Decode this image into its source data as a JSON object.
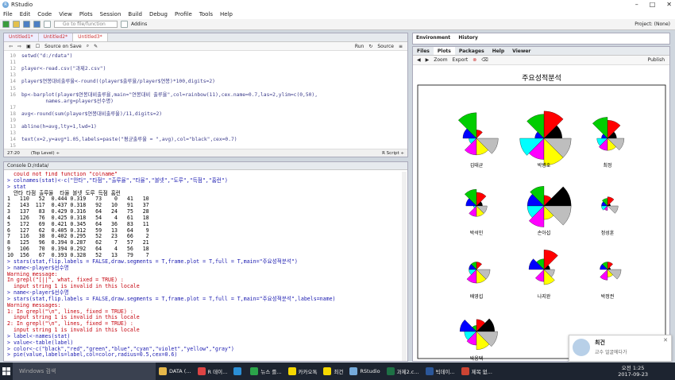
{
  "window": {
    "title": "RStudio"
  },
  "menu": [
    "File",
    "Edit",
    "Code",
    "View",
    "Plots",
    "Session",
    "Build",
    "Debug",
    "Profile",
    "Tools",
    "Help"
  ],
  "toolbar": {
    "goto_placeholder": "Go to file/function",
    "addins": "Addins",
    "project": "Project: (None)"
  },
  "editor": {
    "tabs": [
      "Untitled1*",
      "Untitled2*",
      "Untitled3*"
    ],
    "source_on_save": "Source on Save",
    "run": "Run",
    "source": "Source",
    "lines": [
      {
        "n": "10",
        "t": "setwd(\"d:/rdata\")"
      },
      {
        "n": "11",
        "t": ""
      },
      {
        "n": "12",
        "t": "player<-read.csv(\"과제2.csv\")"
      },
      {
        "n": "13",
        "t": ""
      },
      {
        "n": "14",
        "t": "player$연봉대비출루율<-round((player$출루율/player$연봉)*100,digits=2)"
      },
      {
        "n": "15",
        "t": ""
      },
      {
        "n": "16",
        "t": "bp<-barplot(player$연봉대비출루율,main=\"연봉대비 출루율\",col=rainbow(11),cex.name=0.7,las=2,ylim=c(0,50),"
      },
      {
        "n": "",
        "t": "        names.arg=player$선수명)"
      },
      {
        "n": "17",
        "t": ""
      },
      {
        "n": "18",
        "t": "avg<-round(sum(player$연봉대비출루율)/11,digits=2)"
      },
      {
        "n": "19",
        "t": ""
      },
      {
        "n": "13",
        "t": "abline(h=avg,lty=1,lwd=1)"
      },
      {
        "n": "13",
        "t": ""
      },
      {
        "n": "14",
        "t": "text(x=2,y=avg*1.05,labels=paste(\"평균출루율 = \",avg),col=\"black\",cex=0.7)"
      },
      {
        "n": "15",
        "t": ""
      }
    ],
    "status_pos": "27:20",
    "status_level": "(Top Level) ÷",
    "status_type": "R Script ÷"
  },
  "console": {
    "title": "Console  D:/rdata/",
    "lines": [
      {
        "k": "err",
        "t": "  could not find function \"colname\""
      },
      {
        "k": "cmd",
        "t": "> colnames(stat)<-c(\"안타\",\"타점\",\"출루율\",\"타율\",\"볼넷\",\"도루\",\"득점\",\"홈런\")"
      },
      {
        "k": "cmd",
        "t": "> stat"
      },
      {
        "k": "out",
        "t": "  안타 타점 출루율  타율 볼넷 도루 득점 홈런"
      },
      {
        "k": "out",
        "t": "1   110   52  0.444 0.319   73    0   41   10"
      },
      {
        "k": "out",
        "t": "2   143  117  0.437 0.318   92   10   91   37"
      },
      {
        "k": "out",
        "t": "3   137   83  0.429 0.316   64   24   75   28"
      },
      {
        "k": "out",
        "t": "4   126   76  0.425 0.318   54    4   61   18"
      },
      {
        "k": "out",
        "t": "5   172   69  0.421 0.345   64   36   83   11"
      },
      {
        "k": "out",
        "t": "6   127   62  0.405 0.312   59   13   64    9"
      },
      {
        "k": "out",
        "t": "7   116   38  0.402 0.295   52   23   66    2"
      },
      {
        "k": "out",
        "t": "8   125   96  0.394 0.287   62    7   57   21"
      },
      {
        "k": "out",
        "t": "9   106   70  0.394 0.292   64    4   56   18"
      },
      {
        "k": "out",
        "t": "10  156   67  0.393 0.328   52   13   79    7"
      },
      {
        "k": "cmd",
        "t": "> stars(stat,flip.labels = FALSE,draw.segments = T,frame.plot = T,full = T,main=\"주요성적분석\")"
      },
      {
        "k": "cmd",
        "t": "> name<-player$선수명"
      },
      {
        "k": "err",
        "t": "Warning message:"
      },
      {
        "k": "err",
        "t": "In grepl(\"[||\", what, fixed = TRUE) :"
      },
      {
        "k": "err",
        "t": "  input string 1 is invalid in this locale"
      },
      {
        "k": "cmd",
        "t": "> name<-player$선수명"
      },
      {
        "k": "cmd",
        "t": "> stars(stat,flip.labels = FALSE,draw.segments = T,frame.plot = T,full = T,main=\"주요성적분석\",labels=name)"
      },
      {
        "k": "err",
        "t": "Warning messages:"
      },
      {
        "k": "err",
        "t": "1: In grepl(\"\\n\", lines, fixed = TRUE) :"
      },
      {
        "k": "err",
        "t": "  input string 1 is invalid in this locale"
      },
      {
        "k": "err",
        "t": "2: In grepl(\"\\n\", lines, fixed = TRUE) :"
      },
      {
        "k": "err",
        "t": "  input string 1 is invalid in this locale"
      },
      {
        "k": "cmd",
        "t": "> label<-names(stat)"
      },
      {
        "k": "cmd",
        "t": "> value<-table(label)"
      },
      {
        "k": "cmd",
        "t": "> color<-c(\"black\",\"red\",\"green\",\"blue\",\"cyan\",\"violet\",\"yellow\",\"gray\")"
      },
      {
        "k": "cmd",
        "t": "> pie(value,labels=label,col=color,radius=0.5,cex=0.6)"
      }
    ]
  },
  "env_tabs": [
    "Environment",
    "History"
  ],
  "files_tabs": [
    "Files",
    "Plots",
    "Packages",
    "Help",
    "Viewer"
  ],
  "plot_toolbar": {
    "zoom": "Zoom",
    "export": "Export",
    "publish": "Publish"
  },
  "plot": {
    "title": "주요성적분석",
    "segment_colors": [
      "#000000",
      "#ff0000",
      "#00cd00",
      "#0000ff",
      "#00ffff",
      "#ff00ff",
      "#ffff00",
      "#bebebe"
    ],
    "players": [
      "김태균",
      "박병호",
      "최정",
      "박석민",
      "손아섭",
      "정성훈",
      "배영섭",
      "나지완",
      "박정권",
      "박용택"
    ],
    "stars": [
      {
        "r": [
          0.0,
          0.28,
          0.85,
          0.45,
          0.25,
          0.55,
          0.55,
          0.72
        ]
      },
      {
        "r": [
          0.6,
          0.9,
          0.8,
          0.3,
          0.8,
          0.7,
          0.9,
          0.9
        ]
      },
      {
        "r": [
          0.3,
          0.6,
          0.7,
          0.2,
          0.35,
          0.4,
          0.4,
          0.55
        ]
      },
      {
        "r": [
          0.2,
          0.45,
          0.55,
          0.35,
          0.1,
          0.35,
          0.35,
          0.35
        ]
      },
      {
        "r": [
          0.9,
          0.35,
          0.65,
          0.55,
          0.55,
          0.7,
          0.45,
          0.9
        ]
      },
      {
        "r": [
          0.1,
          0.3,
          0.25,
          0.2,
          0.2,
          0.15,
          0.0,
          0.35
        ]
      },
      {
        "r": [
          0.0,
          0.25,
          0.25,
          0.25,
          0.25,
          0.45,
          0.45,
          0.45
        ]
      },
      {
        "r": [
          0.2,
          0.65,
          0.35,
          0.5,
          0.0,
          0.4,
          0.5,
          0.35
        ]
      },
      {
        "r": [
          0.1,
          0.25,
          0.25,
          0.25,
          0.0,
          0.35,
          0.25,
          0.45
        ]
      },
      {
        "r": [
          0.6,
          0.4,
          0.2,
          0.55,
          0.4,
          0.45,
          0.6,
          0.7
        ]
      }
    ]
  },
  "notification": {
    "title": "최건",
    "message": "교수 얼굴에다가"
  },
  "taskbar": {
    "search": "Windows 검색",
    "items": [
      "DATA (...",
      "R 데이...",
      "",
      "뉴스 를...",
      "카카오톡",
      "최건",
      "RStudio",
      "과제2.c...",
      "빅데이...",
      "제목 없..."
    ],
    "time": "오전 1:25",
    "date": "2017-09-23"
  }
}
